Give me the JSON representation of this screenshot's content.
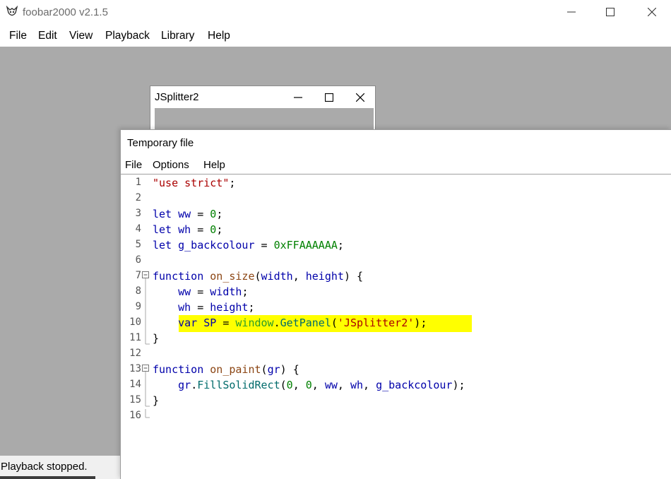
{
  "app": {
    "title": "foobar2000 v2.1.5",
    "menu": [
      "File",
      "Edit",
      "View",
      "Playback",
      "Library",
      "Help"
    ]
  },
  "status": {
    "text": "Playback stopped."
  },
  "jsplitter": {
    "title": "JSplitter2"
  },
  "editor": {
    "title": "Temporary file",
    "menu": [
      "File",
      "Options",
      "Help"
    ],
    "highlight_line": 10,
    "lines": [
      {
        "n": "1",
        "code": "\"use strict\";"
      },
      {
        "n": "2",
        "code": ""
      },
      {
        "n": "3",
        "code": "let ww = 0;"
      },
      {
        "n": "4",
        "code": "let wh = 0;"
      },
      {
        "n": "5",
        "code": "let g_backcolour = 0xFFAAAAAA;"
      },
      {
        "n": "6",
        "code": ""
      },
      {
        "n": "7",
        "code": "function on_size(width, height) {"
      },
      {
        "n": "8",
        "code": "    ww = width;"
      },
      {
        "n": "9",
        "code": "    wh = height;"
      },
      {
        "n": "10",
        "code": "    var SP = window.GetPanel('JSplitter2');"
      },
      {
        "n": "11",
        "code": "}"
      },
      {
        "n": "12",
        "code": ""
      },
      {
        "n": "13",
        "code": "function on_paint(gr) {"
      },
      {
        "n": "14",
        "code": "    gr.FillSolidRect(0, 0, ww, wh, g_backcolour);"
      },
      {
        "n": "15",
        "code": "}"
      },
      {
        "n": "16",
        "code": ""
      }
    ]
  },
  "colors": {
    "workspace": "#aaaaaa",
    "highlight": "#ffff00",
    "keyword": "#0000aa",
    "number": "#008000",
    "string": "#aa0000"
  }
}
